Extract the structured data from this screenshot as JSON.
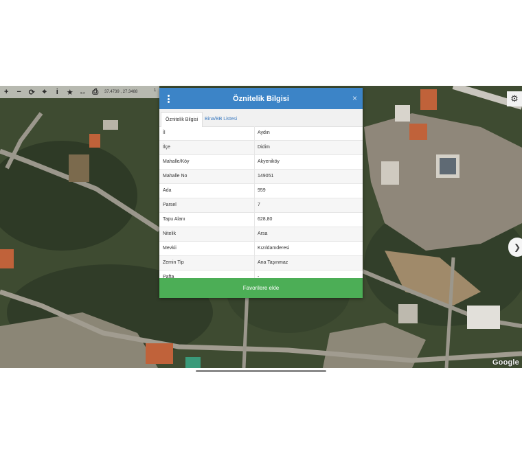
{
  "toolbar": {
    "buttons": [
      {
        "name": "zoom-in-icon",
        "glyph": "+"
      },
      {
        "name": "zoom-out-icon",
        "glyph": "−"
      },
      {
        "name": "refresh-icon",
        "glyph": "⟳"
      },
      {
        "name": "locate-icon",
        "glyph": "⌖"
      },
      {
        "name": "info-icon",
        "glyph": "i"
      },
      {
        "name": "star-icon",
        "glyph": "★"
      },
      {
        "name": "measure-icon",
        "glyph": "↔"
      },
      {
        "name": "print-icon",
        "glyph": "⎙"
      }
    ],
    "coordinates": "37.4739 , 27.3488",
    "extra": "1"
  },
  "dialog": {
    "title": "Öznitelik Bilgisi",
    "close": "×",
    "tabs": [
      "Öznitelik Bilgisi",
      "Bina/BB Listesi"
    ],
    "rows": [
      {
        "key": "İl",
        "value": "Aydın"
      },
      {
        "key": "İlçe",
        "value": "Didim"
      },
      {
        "key": "Mahalle/Köy",
        "value": "Akyeniköy"
      },
      {
        "key": "Mahalle No",
        "value": "149051"
      },
      {
        "key": "Ada",
        "value": "959"
      },
      {
        "key": "Parsel",
        "value": "7"
      },
      {
        "key": "Tapu Alanı",
        "value": "628,80"
      },
      {
        "key": "Nitelik",
        "value": "Arsa"
      },
      {
        "key": "Mevkii",
        "value": "Kızıldamderesi"
      },
      {
        "key": "Zemin Tip",
        "value": "Ana Taşınmaz"
      },
      {
        "key": "Pafta",
        "value": "-"
      }
    ],
    "favorite_button": "Favorilere ekle"
  },
  "map": {
    "settings_icon": "⚙",
    "arrow_icon": "❯",
    "attribution": "Google"
  },
  "colors": {
    "header": "#3c84c7",
    "favorite_button": "#4cae56",
    "tab_link": "#3c7ac0"
  }
}
